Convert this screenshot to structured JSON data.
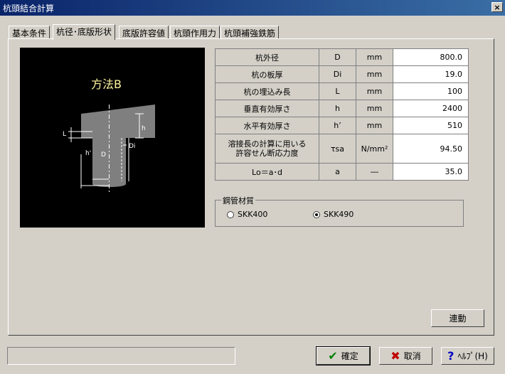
{
  "window": {
    "title": "杭頭結合計算",
    "close_glyph": "×"
  },
  "tabs": [
    {
      "label": "基本条件"
    },
    {
      "label": "杭径･底版形状"
    },
    {
      "label": "底版許容値"
    },
    {
      "label": "杭頭作用力"
    },
    {
      "label": "杭頭補強鉄筋"
    }
  ],
  "diagram": {
    "method": "方法B",
    "labels": {
      "h": "h",
      "L": "L",
      "D": "D",
      "Di": "Di",
      "hprime": "h'"
    },
    "colors": {
      "pile": "#7f7f7f",
      "slab": "#7f7f7f",
      "line": "#ffffff"
    }
  },
  "params": [
    {
      "label": "杭外径",
      "symbol": "D",
      "unit": "mm",
      "value": "800.0"
    },
    {
      "label": "杭の板厚",
      "symbol": "Di",
      "unit": "mm",
      "value": "19.0"
    },
    {
      "label": "杭の埋込み長",
      "symbol": "L",
      "unit": "mm",
      "value": "100"
    },
    {
      "label": "垂直有効厚さ",
      "symbol": "h",
      "unit": "mm",
      "value": "2400"
    },
    {
      "label": "水平有効厚さ",
      "symbol": "h’",
      "unit": "mm",
      "value": "510"
    },
    {
      "label_line1": "溶接長の計算に用いる",
      "label_line2": "許容せん断応力度",
      "symbol": "τsa",
      "unit": "N/mm²",
      "value": "94.50"
    },
    {
      "label": "Lo＝a･d",
      "symbol": "a",
      "unit": "―",
      "value": "35.0"
    }
  ],
  "material": {
    "legend": "鋼管材質",
    "options": [
      {
        "label": "SKK400",
        "selected": false
      },
      {
        "label": "SKK490",
        "selected": true
      }
    ]
  },
  "buttons": {
    "link": "連動",
    "ok": "確定",
    "cancel": "取消",
    "help": "ﾍﾙﾌﾟ(H)"
  },
  "status": {
    "text": ""
  },
  "icon_colors": {
    "ok_check": "#008000",
    "cancel_x": "#c00000",
    "help_q": "#0000c0"
  }
}
